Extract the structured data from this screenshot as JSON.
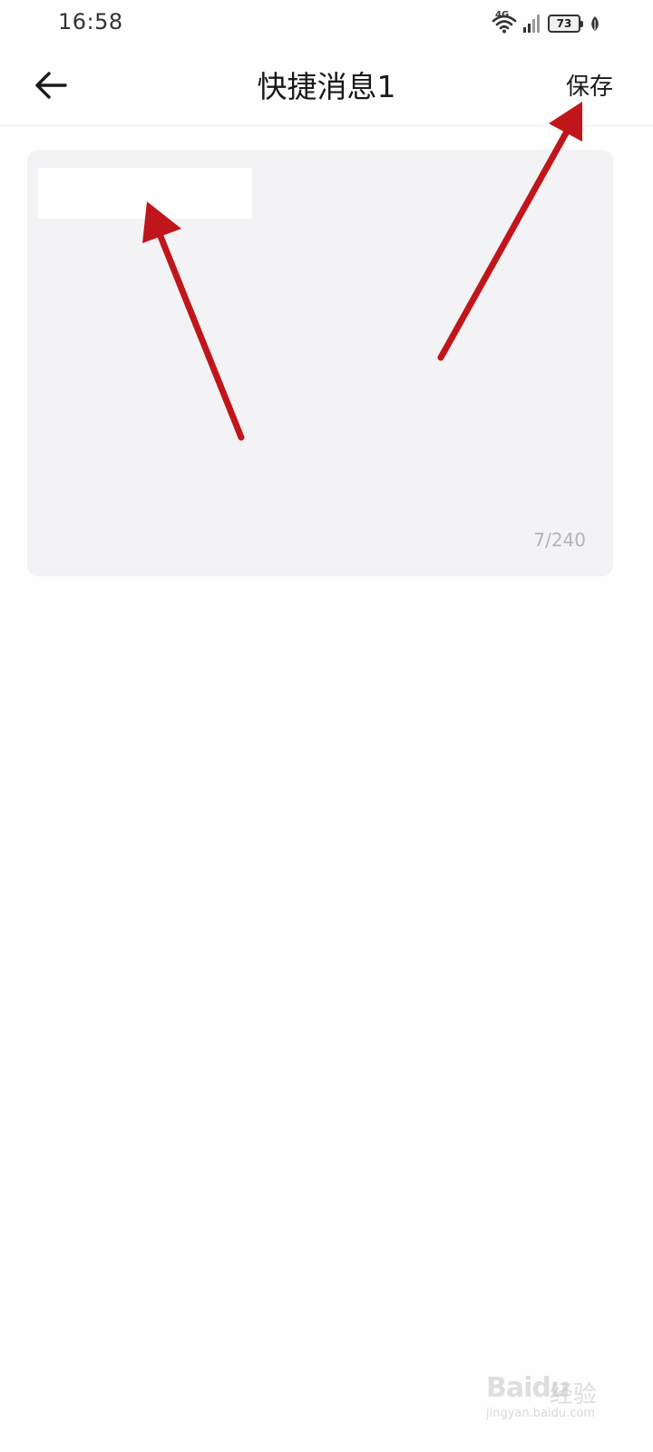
{
  "status_bar": {
    "time": "16:58",
    "network_label": "4G",
    "battery_level": "73",
    "icons": [
      "wifi-icon",
      "signal-icon",
      "battery-icon",
      "leaf-icon"
    ]
  },
  "header": {
    "back_icon": "arrow-left-icon",
    "title": "快捷消息1",
    "save_label": "保存"
  },
  "editor": {
    "char_count": "7/240"
  },
  "watermark": {
    "brand": "Baidu",
    "sub": "经验",
    "url": "jingyan.baidu.com"
  },
  "colors": {
    "background": "#fefefe",
    "editor_background": "#f3f2f4",
    "annotation_arrow": "#c0161b",
    "muted_text": "#b4b4b4"
  }
}
